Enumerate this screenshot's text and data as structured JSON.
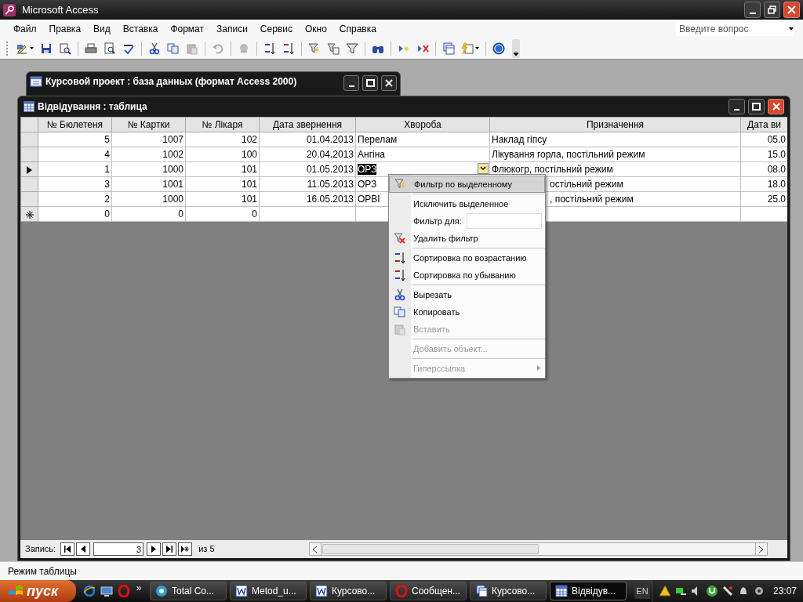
{
  "app": {
    "title": "Microsoft Access"
  },
  "menu_bar": [
    "Файл",
    "Правка",
    "Вид",
    "Вставка",
    "Формат",
    "Записи",
    "Сервис",
    "Окно",
    "Справка"
  ],
  "help_search": {
    "placeholder": "Введите вопрос"
  },
  "db_window": {
    "title": "Курсовой проект : база данных (формат Access 2000)"
  },
  "table_window": {
    "title": "Відвідування : таблица"
  },
  "table": {
    "columns": [
      "№ Бюлетеня",
      "№ Картки",
      "№ Лікаря",
      "Дата звернення",
      "Хвороба",
      "Призначення",
      "Дата ви"
    ],
    "rows": [
      {
        "kind": "record",
        "selected": false,
        "cells": [
          "5",
          "1007",
          "102",
          "01.04.2013",
          "Перелам",
          "Наклад гіпсу",
          "05.0"
        ]
      },
      {
        "kind": "record",
        "selected": false,
        "cells": [
          "4",
          "1002",
          "100",
          "20.04.2013",
          "Ангіна",
          "Лікування горла, постільний режим",
          "15.0"
        ]
      },
      {
        "kind": "record",
        "selected": true,
        "cells": [
          "1",
          "1000",
          "101",
          "01.05.2013",
          "ОРЗ",
          "Флюкогр, постільний режим",
          "08.0"
        ]
      },
      {
        "kind": "record",
        "selected": false,
        "cells": [
          "3",
          "1001",
          "101",
          "11.05.2013",
          "ОРЗ",
          "остільний режим",
          "18.0"
        ]
      },
      {
        "kind": "record",
        "selected": false,
        "cells": [
          "2",
          "1000",
          "101",
          "16.05.2013",
          "ОРВІ",
          ", постільний режим",
          "25.0"
        ]
      },
      {
        "kind": "new",
        "selected": false,
        "cells": [
          "0",
          "0",
          "0",
          "",
          "",
          "",
          ""
        ]
      }
    ]
  },
  "context_menu": [
    {
      "kind": "item",
      "label": "Фильтр по выделенному",
      "selected": true,
      "disabled": false
    },
    {
      "kind": "separator"
    },
    {
      "kind": "item",
      "label": "Исключить выделенное",
      "selected": false,
      "disabled": false
    },
    {
      "kind": "field",
      "label": "Фильтр для:"
    },
    {
      "kind": "item",
      "label": "Удалить фильтр",
      "selected": false,
      "disabled": false
    },
    {
      "kind": "separator"
    },
    {
      "kind": "item",
      "label": "Сортировка по возрастанию",
      "selected": false,
      "disabled": false
    },
    {
      "kind": "item",
      "label": "Сортировка по убыванию",
      "selected": false,
      "disabled": false
    },
    {
      "kind": "separator"
    },
    {
      "kind": "item",
      "label": "Вырезать",
      "selected": false,
      "disabled": false
    },
    {
      "kind": "item",
      "label": "Копировать",
      "selected": false,
      "disabled": false
    },
    {
      "kind": "item",
      "label": "Вставить",
      "selected": false,
      "disabled": true
    },
    {
      "kind": "separator"
    },
    {
      "kind": "item",
      "label": "Добавить объект...",
      "selected": false,
      "disabled": true
    },
    {
      "kind": "separator"
    },
    {
      "kind": "submenu",
      "label": "Гиперссылка",
      "selected": false,
      "disabled": true
    }
  ],
  "navigation": {
    "label": "Запись:",
    "current": "3",
    "of": "из",
    "total": "5"
  },
  "status_bar": {
    "text": "Режим таблицы"
  },
  "taskbar": {
    "start": "пуск",
    "more": "»",
    "tasks": [
      {
        "kind": "commander",
        "label": "Total Co...",
        "selected": false
      },
      {
        "kind": "word",
        "label": "Metod_u...",
        "selected": false
      },
      {
        "kind": "word",
        "label": "Курсово...",
        "selected": false
      },
      {
        "kind": "opera",
        "label": "Сообщен...",
        "selected": false
      },
      {
        "kind": "access",
        "label": "Курсово...",
        "selected": false
      },
      {
        "kind": "table",
        "label": "Відвідув...",
        "selected": true
      }
    ],
    "language": "EN",
    "clock": "23:07"
  }
}
